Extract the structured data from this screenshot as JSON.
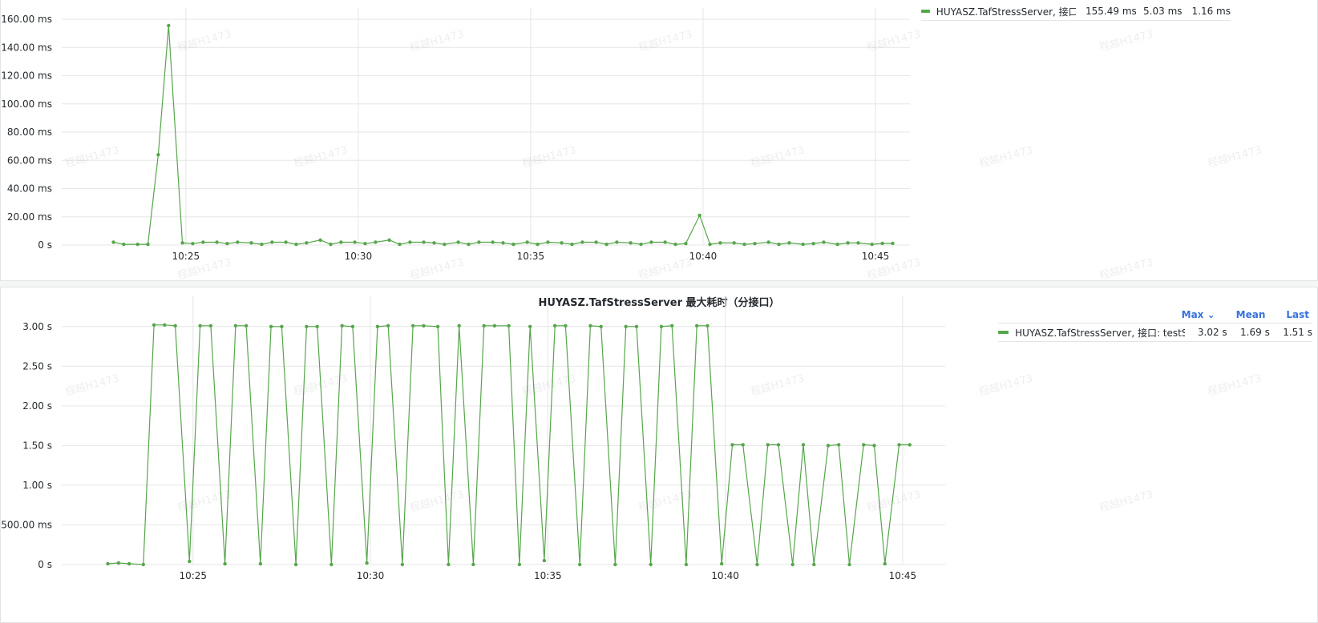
{
  "colors": {
    "series": "#56a64b",
    "legend_header": "#3871dc"
  },
  "watermark_text": "程越H1473",
  "panels": [
    {
      "title": "",
      "legend": {
        "headers": [],
        "series_name": "HUYASZ.TafStressServer, 接口: testStr",
        "max": "155.49 ms",
        "mean": "5.03 ms",
        "last": "1.16 ms"
      }
    },
    {
      "title": "HUYASZ.TafStressServer 最大耗时（分接口）",
      "legend": {
        "headers": [
          "Max ⌄",
          "Mean",
          "Last"
        ],
        "series_name": "HUYASZ.TafStressServer, 接口: testStr",
        "max": "3.02 s",
        "mean": "1.69 s",
        "last": "1.51 s"
      }
    }
  ],
  "chart_data": [
    {
      "type": "line",
      "ylim": [
        0,
        160
      ],
      "y_unit": "ms",
      "y_ticks": [
        0,
        20,
        40,
        60,
        80,
        100,
        120,
        140,
        160
      ],
      "y_tick_labels": [
        "0 s",
        "20.00 ms",
        "40.00 ms",
        "60.00 ms",
        "80.00 ms",
        "100.00 ms",
        "120.00 ms",
        "140.00 ms",
        "160.00 ms"
      ],
      "x_tick_labels": [
        "10:25",
        "10:30",
        "10:35",
        "10:40",
        "10:45"
      ],
      "x_ticks_min": [
        25,
        30,
        35,
        40,
        45
      ],
      "xlim": [
        21.4,
        46.0
      ],
      "series": [
        {
          "x": [
            22.9,
            23.2,
            23.6,
            23.9,
            24.2,
            24.5,
            24.9,
            25.2,
            25.5,
            25.9,
            26.2,
            26.5,
            26.9,
            27.2,
            27.5,
            27.9,
            28.2,
            28.5,
            28.9,
            29.2,
            29.5,
            29.9,
            30.2,
            30.5,
            30.9,
            31.2,
            31.5,
            31.9,
            32.2,
            32.5,
            32.9,
            33.2,
            33.5,
            33.9,
            34.2,
            34.5,
            34.9,
            35.2,
            35.5,
            35.9,
            36.2,
            36.5,
            36.9,
            37.2,
            37.5,
            37.9,
            38.2,
            38.5,
            38.9,
            39.2,
            39.5,
            39.9,
            40.2,
            40.5,
            40.9,
            41.2,
            41.5,
            41.9,
            42.2,
            42.5,
            42.9,
            43.2,
            43.5,
            43.9,
            44.2,
            44.5,
            44.9,
            45.2,
            45.5
          ],
          "y": [
            2,
            0.5,
            0.5,
            0.5,
            64,
            155.5,
            1.5,
            1,
            2,
            2,
            1,
            2,
            1.5,
            0.5,
            2,
            2,
            0.5,
            1.5,
            3.5,
            0.5,
            2,
            2,
            1,
            2,
            3.5,
            0.5,
            2,
            2,
            1.5,
            0.5,
            2,
            0.5,
            2,
            2,
            1.5,
            0.5,
            2,
            0.5,
            2,
            1.5,
            0.5,
            2,
            2,
            0.5,
            2,
            1.5,
            0.5,
            2,
            2,
            0.5,
            1,
            21,
            0.5,
            1.5,
            1.5,
            0.5,
            1,
            2,
            0.5,
            1.5,
            0.5,
            1,
            2,
            0.5,
            1.5,
            1.5,
            0.5,
            1.16,
            1.16
          ]
        }
      ]
    },
    {
      "type": "line",
      "ylim": [
        0,
        3.25
      ],
      "y_unit": "s",
      "y_ticks": [
        0,
        0.5,
        1.0,
        1.5,
        2.0,
        2.5,
        3.0
      ],
      "y_tick_labels": [
        "0 s",
        "500.00 ms",
        "1.00 s",
        "1.50 s",
        "2.00 s",
        "2.50 s",
        "3.00 s"
      ],
      "x_tick_labels": [
        "10:25",
        "10:30",
        "10:35",
        "10:40",
        "10:45"
      ],
      "x_ticks_min": [
        25,
        30,
        35,
        40,
        45
      ],
      "xlim": [
        21.3,
        46.2
      ],
      "series": [
        {
          "x": [
            22.6,
            22.9,
            23.2,
            23.6,
            23.9,
            24.2,
            24.5,
            24.9,
            25.2,
            25.5,
            25.9,
            26.2,
            26.5,
            26.9,
            27.2,
            27.5,
            27.9,
            28.2,
            28.5,
            28.9,
            29.2,
            29.5,
            29.9,
            30.2,
            30.5,
            30.9,
            31.2,
            31.5,
            31.9,
            32.2,
            32.5,
            32.9,
            33.2,
            33.5,
            33.9,
            34.2,
            34.5,
            34.9,
            35.2,
            35.5,
            35.9,
            36.2,
            36.5,
            36.9,
            37.2,
            37.5,
            37.9,
            38.2,
            38.5,
            38.9,
            39.2,
            39.5,
            39.9,
            40.2,
            40.5,
            40.9,
            41.2,
            41.5,
            41.9,
            42.2,
            42.5,
            42.9,
            43.2,
            43.5,
            43.9,
            44.2,
            44.5,
            44.9,
            45.2
          ],
          "y": [
            0.01,
            0.02,
            0.01,
            0.0,
            3.02,
            3.02,
            3.01,
            0.04,
            3.01,
            3.01,
            0.01,
            3.01,
            3.01,
            0.01,
            3.0,
            3.0,
            0.0,
            3.0,
            3.0,
            0.0,
            3.01,
            3.0,
            0.02,
            3.0,
            3.01,
            0.0,
            3.01,
            3.01,
            3.0,
            0.0,
            3.01,
            0.0,
            3.01,
            3.01,
            3.01,
            0.0,
            3.0,
            0.05,
            3.01,
            3.01,
            0.0,
            3.01,
            3.0,
            0.0,
            3.0,
            3.0,
            0.0,
            3.0,
            3.01,
            0.0,
            3.01,
            3.01,
            0.01,
            1.51,
            1.51,
            0.0,
            1.51,
            1.51,
            0.0,
            1.51,
            0.0,
            1.5,
            1.51,
            0.0,
            1.51,
            1.5,
            0.01,
            1.51,
            1.51
          ]
        }
      ]
    }
  ]
}
